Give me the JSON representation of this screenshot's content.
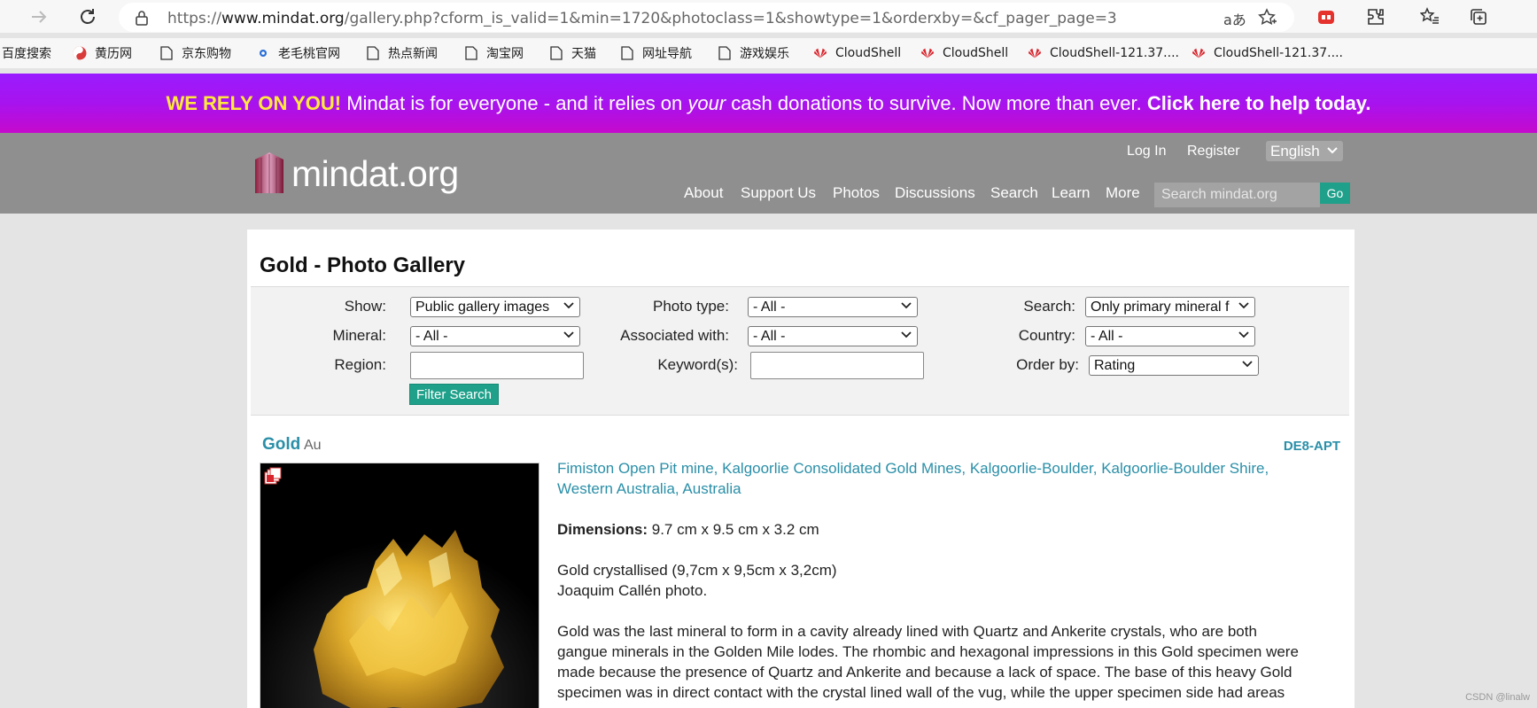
{
  "browser": {
    "url_prefix": "https://",
    "url_host": "www.mindat.org",
    "url_path": "/gallery.php?cform_is_valid=1&min=1720&photoclass=1&showtype=1&orderxby=&cf_pager_page=3",
    "read_aloud_glyph": "aあ",
    "bookmarks": [
      {
        "label": "百度搜索",
        "icon": "none"
      },
      {
        "label": "黄历网",
        "icon": "yinyang-icon"
      },
      {
        "label": "京东购物",
        "icon": "page-icon"
      },
      {
        "label": "老毛桃官网",
        "icon": "dot-icon"
      },
      {
        "label": "热点新闻",
        "icon": "page-icon"
      },
      {
        "label": "淘宝网",
        "icon": "page-icon"
      },
      {
        "label": "天猫",
        "icon": "page-icon"
      },
      {
        "label": "网址导航",
        "icon": "page-icon"
      },
      {
        "label": "游戏娱乐",
        "icon": "page-icon"
      },
      {
        "label": "CloudShell",
        "icon": "huawei-icon"
      },
      {
        "label": "CloudShell",
        "icon": "huawei-icon"
      },
      {
        "label": "CloudShell-121.37....",
        "icon": "huawei-icon"
      },
      {
        "label": "CloudShell-121.37....",
        "icon": "huawei-icon"
      }
    ]
  },
  "banner": {
    "lead": "WE RELY ON YOU!",
    "text1": " Mindat is for everyone - and it relies on ",
    "emph": "your",
    "text2": " cash donations to survive. Now more than ever. ",
    "cta": "Click here to help today."
  },
  "header": {
    "logo_text": "mindat.org",
    "login": "Log In",
    "register": "Register",
    "language": "English",
    "menu": [
      "About",
      "Support Us",
      "Photos",
      "Discussions",
      "Search",
      "Learn",
      "More"
    ],
    "search_placeholder": "Search mindat.org",
    "go": "Go"
  },
  "page": {
    "title": "Gold - Photo Gallery",
    "filters": {
      "show_label": "Show:",
      "show_value": "Public gallery images",
      "phototype_label": "Photo type:",
      "phototype_value": "- All -",
      "search_label": "Search:",
      "search_value": "Only primary mineral f",
      "mineral_label": "Mineral:",
      "mineral_value": "- All -",
      "assoc_label": "Associated with:",
      "assoc_value": "- All -",
      "country_label": "Country:",
      "country_value": "- All -",
      "region_label": "Region:",
      "region_value": "",
      "keyword_label": "Keyword(s):",
      "keyword_value": "",
      "order_label": "Order by:",
      "order_value": "Rating",
      "button": "Filter Search"
    },
    "entry": {
      "mineral": "Gold",
      "formula": "Au",
      "photo_id": "DE8-APT",
      "locality_line1": "Fimiston Open Pit mine, Kalgoorlie Consolidated Gold Mines, Kalgoorlie-Boulder, Kalgoorlie-Boulder Shire,",
      "locality_line2": "Western Australia, Australia",
      "dimensions_label": "Dimensions:",
      "dimensions_value": " 9.7 cm x 9.5 cm x 3.2 cm",
      "caption1": "Gold crystallised (9,7cm x 9,5cm x 3,2cm)",
      "caption2": "Joaquim Callén photo.",
      "body1": "Gold was the last mineral to form in a cavity already lined with Quartz and Ankerite crystals, who are both",
      "body2": "gangue minerals in the Golden Mile lodes. The rhombic and hexagonal impressions in this Gold specimen were",
      "body3": "made because the presence of Quartz and Ankerite and because a lack of space. The base of this heavy Gold",
      "body4": "specimen was in direct contact with the crystal lined wall of the vug, while the upper specimen side had areas"
    }
  },
  "watermark": "CSDN @linalw"
}
